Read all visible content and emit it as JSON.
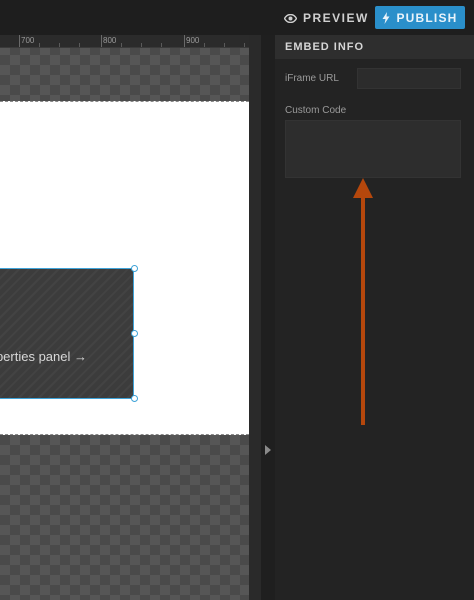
{
  "topbar": {
    "preview_label": "PREVIEW",
    "publish_label": "PUBLISH",
    "publish_color": "#2a8fca"
  },
  "ruler": {
    "labels": [
      "700",
      "800",
      "900"
    ]
  },
  "canvas": {
    "embed_text": "perties panel →",
    "selection_color": "#3fa3d8"
  },
  "panel": {
    "title": "EMBED INFO",
    "iframe_label": "iFrame URL",
    "iframe_value": "",
    "custom_code_label": "Custom Code",
    "custom_code_value": ""
  },
  "annotation": {
    "arrow_color": "#b5470c"
  },
  "icons": {
    "preview": "eye-icon",
    "publish": "lightning-icon",
    "collapse": "chevron-right-icon"
  }
}
